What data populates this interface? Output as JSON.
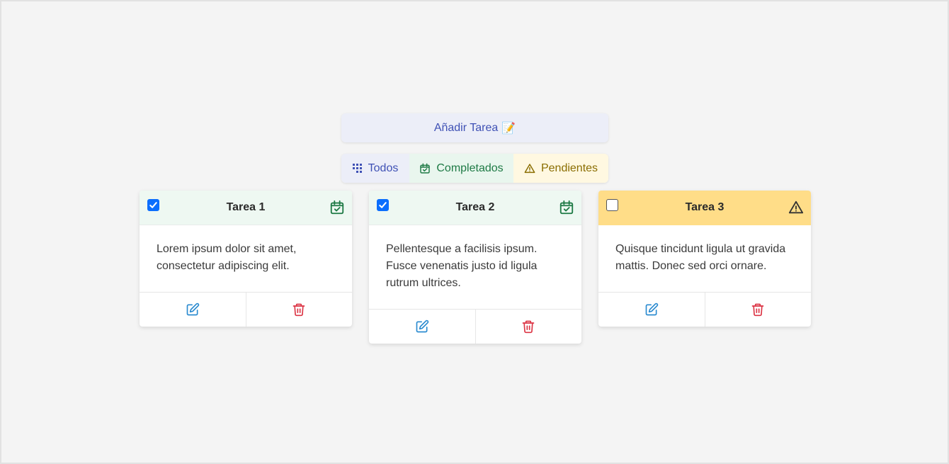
{
  "add_button": {
    "label": "Añadir Tarea",
    "emoji": "📝"
  },
  "filters": [
    {
      "label": "Todos",
      "icon": "grid-icon"
    },
    {
      "label": "Completados",
      "icon": "calendar-check-icon"
    },
    {
      "label": "Pendientes",
      "icon": "warning-icon"
    }
  ],
  "colors": {
    "primary": "#3f51b5",
    "success": "#1e7a45",
    "warning": "#ffdd88",
    "edit": "#2b8bd0",
    "delete": "#dc3545",
    "checkbox": "#0b6efd"
  },
  "tasks": [
    {
      "title": "Tarea 1",
      "completed": true,
      "status_icon": "calendar-check-icon",
      "description": "Lorem ipsum dolor sit amet, consectetur adipiscing elit."
    },
    {
      "title": "Tarea 2",
      "completed": true,
      "status_icon": "calendar-check-icon",
      "description": "Pellentesque a facilisis ipsum. Fusce venenatis justo id ligula rutrum ultrices."
    },
    {
      "title": "Tarea 3",
      "completed": false,
      "status_icon": "warning-icon",
      "description": "Quisque tincidunt ligula ut gravida mattis. Donec sed orci ornare."
    }
  ]
}
